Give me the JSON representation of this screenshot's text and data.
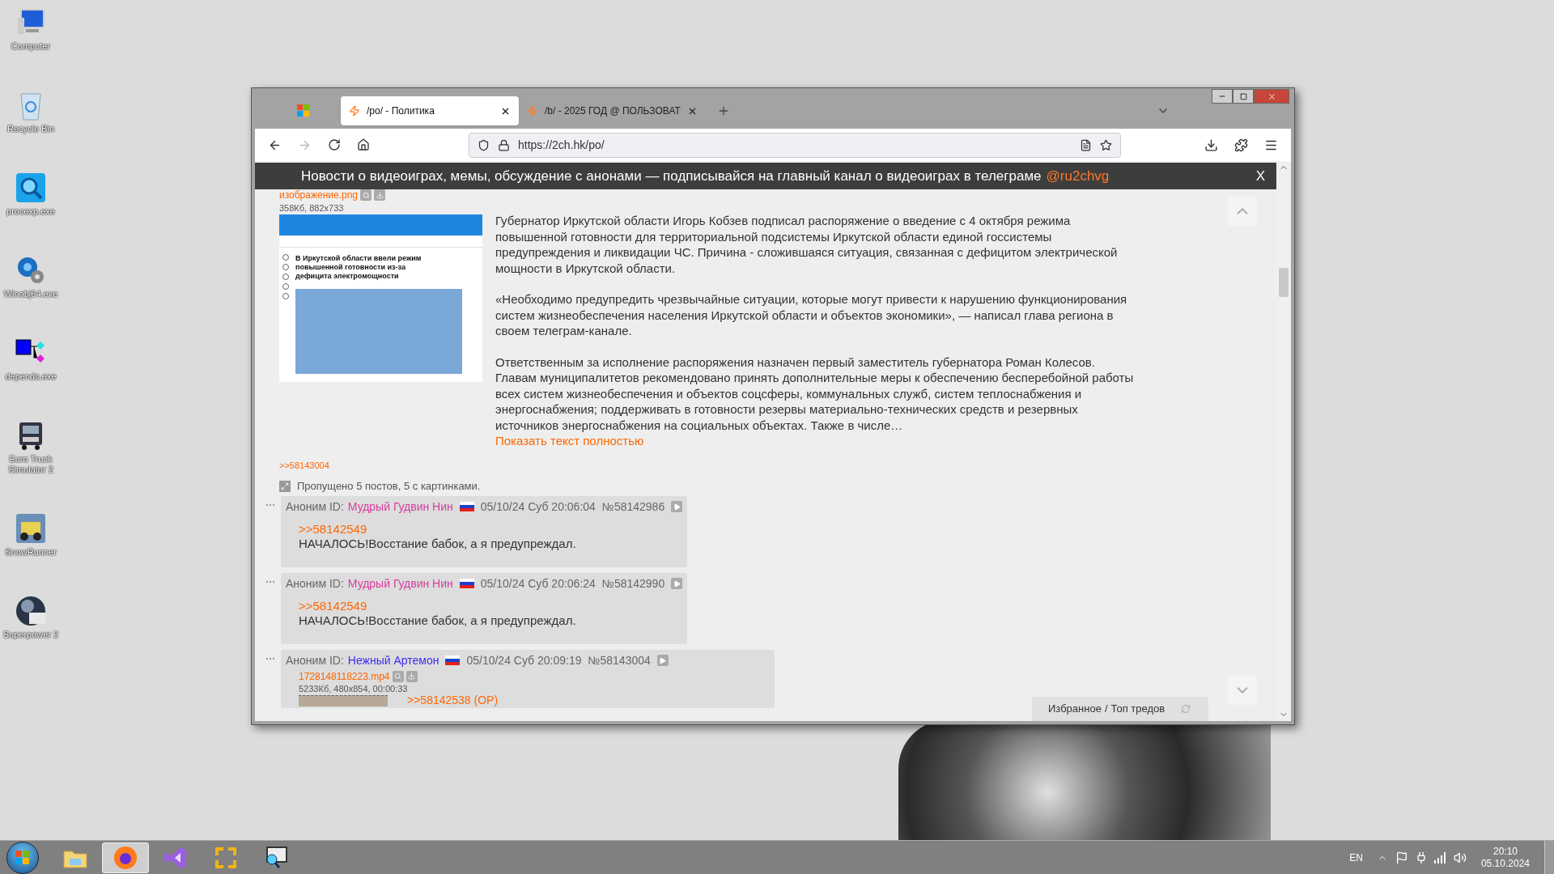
{
  "desktop_icons": [
    {
      "kind": "computer",
      "label": "Computer"
    },
    {
      "kind": "recycle-bin",
      "label": "Recycle Bin"
    },
    {
      "kind": "magnifier",
      "label": "procexp.exe"
    },
    {
      "kind": "gears",
      "label": "Winobj64.exe"
    },
    {
      "kind": "tree",
      "label": "depends.exe"
    },
    {
      "kind": "truck",
      "label": "Euro Truck Simulator 2"
    },
    {
      "kind": "snow",
      "label": "SnowRunner"
    },
    {
      "kind": "globe",
      "label": "Superpower 2"
    }
  ],
  "browser": {
    "tabs": [
      {
        "label": "/po/ - Политика",
        "selected": true
      },
      {
        "label": "/b/ - 2025 ГОД @ ПОЛЬЗОВАТ",
        "selected": false
      }
    ],
    "url": "https://2ch.hk/po/",
    "banner": {
      "text": "Новости о видеоиграх, мемы, обсуждение с анонами — подписывайся на главный канал о видеоиграх в телеграме",
      "handle": "@ru2chvg",
      "close": "X"
    },
    "op": {
      "file_name": "изображение.png",
      "file_info": "358Кб, 882x733",
      "thumbnail_headline": "В Иркутской области ввели режим повышенной готовности из-за дефицита электромощности",
      "paragraphs": [
        "Губернатор Иркутской области Игорь Кобзев подписал распоряжение о введение с 4 октября режима повышенной готовности для территориальной подсистемы Иркутской области единой госсистемы предупреждения и ликвидации ЧС. Причина - сложившаяся ситуация, связанная с дефицитом электрической мощности в Иркутской области.",
        "«Необходимо предупредить чрезвычайные ситуации, которые могут привести к нарушению функционирования систем жизнеобеспечения населения Иркутской области и объектов экономики», — написал глава региона в своем телеграм-канале.",
        "Ответственным за исполнение распоряжения назначен первый заместитель губернатора Роман Колесов. Главам муниципалитетов рекомендовано принять дополнительные меры к обеспечению бесперебойной работы всех систем жизнеобеспечения и объектов соцсферы, коммунальных служб, систем теплоснабжения и энергоснабжения; поддерживать в готовности резервы материально-технических средств и резервных источников энергоснабжения на социальных объектах. Также в числе…"
      ],
      "show_more": "Показать текст полностью"
    },
    "reply_link": ">>58143004",
    "skipped": "Пропущено 5 постов, 5 с картинками.",
    "posts": [
      {
        "author": "Аноним ID:",
        "name": "Мудрый Гудвин Нин",
        "color": "#d63ca0",
        "date": "05/10/24 Суб 20:06:04",
        "number": "№58142986",
        "reply": ">>58142549",
        "text": "НАЧАЛОСЬ!Восстание бабок, а я предупреждал."
      },
      {
        "author": "Аноним ID:",
        "name": "Мудрый Гудвин Нин",
        "color": "#d63ca0",
        "date": "05/10/24 Суб 20:06:24",
        "number": "№58142990",
        "reply": ">>58142549",
        "text": "НАЧАЛОСЬ!Восстание бабок, а я предупреждал."
      },
      {
        "author": "Аноним ID:",
        "name": "Нежный Артемон",
        "color": "#3a2cf0",
        "date": "05/10/24 Суб 20:09:19",
        "number": "№58143004",
        "file_name": "1728148118223.mp4",
        "file_info": "5233Кб, 480x854, 00:00:33",
        "reply": ">>58142538 (OP)"
      }
    ],
    "favorites": {
      "left": "Избранное",
      "separator": "/",
      "right": "Топ тредов"
    }
  },
  "taskbar": {
    "apps": [
      {
        "kind": "folder",
        "selected": false
      },
      {
        "kind": "firefox",
        "selected": true
      },
      {
        "kind": "vs",
        "selected": false
      },
      {
        "kind": "brackets",
        "selected": false
      },
      {
        "kind": "monitor",
        "selected": false
      }
    ],
    "language": "EN",
    "time": "20:10",
    "date": "05.10.2024"
  }
}
